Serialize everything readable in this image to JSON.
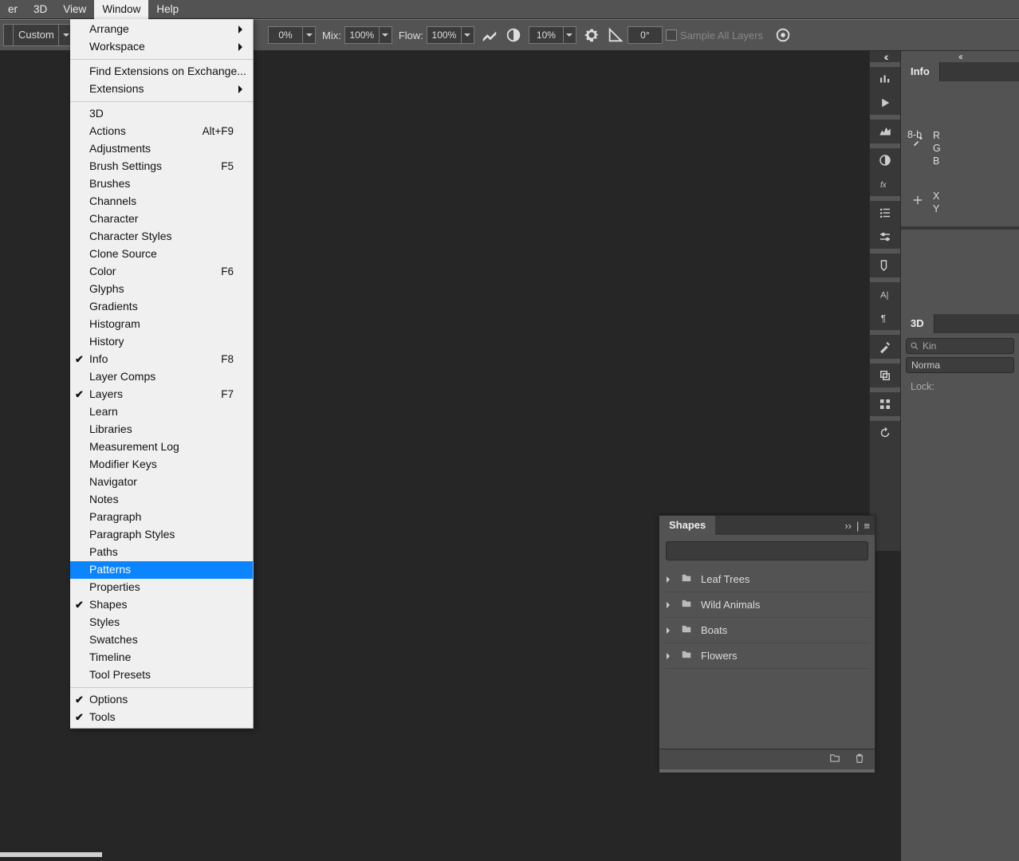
{
  "menubar": {
    "items": [
      {
        "label": "er",
        "active": false
      },
      {
        "label": "3D",
        "active": false
      },
      {
        "label": "View",
        "active": false
      },
      {
        "label": "Window",
        "active": true
      },
      {
        "label": "Help",
        "active": false
      }
    ]
  },
  "optionsbar": {
    "preset_name": "Custom",
    "pct_a": "0%",
    "mix_label": "Mix:",
    "mix_value": "100%",
    "flow_label": "Flow:",
    "flow_value": "100%",
    "smoothing_value": "10%",
    "angle_value": "0°",
    "sample_all_label": "Sample All Layers"
  },
  "window_menu": {
    "groups": [
      [
        {
          "label": "Arrange",
          "submenu": true
        },
        {
          "label": "Workspace",
          "submenu": true
        }
      ],
      [
        {
          "label": "Find Extensions on Exchange..."
        },
        {
          "label": "Extensions",
          "submenu": true
        }
      ],
      [
        {
          "label": "3D"
        },
        {
          "label": "Actions",
          "shortcut": "Alt+F9"
        },
        {
          "label": "Adjustments"
        },
        {
          "label": "Brush Settings",
          "shortcut": "F5"
        },
        {
          "label": "Brushes"
        },
        {
          "label": "Channels"
        },
        {
          "label": "Character"
        },
        {
          "label": "Character Styles"
        },
        {
          "label": "Clone Source"
        },
        {
          "label": "Color",
          "shortcut": "F6"
        },
        {
          "label": "Glyphs"
        },
        {
          "label": "Gradients"
        },
        {
          "label": "Histogram"
        },
        {
          "label": "History"
        },
        {
          "label": "Info",
          "shortcut": "F8",
          "checked": true
        },
        {
          "label": "Layer Comps"
        },
        {
          "label": "Layers",
          "shortcut": "F7",
          "checked": true
        },
        {
          "label": "Learn"
        },
        {
          "label": "Libraries"
        },
        {
          "label": "Measurement Log"
        },
        {
          "label": "Modifier Keys"
        },
        {
          "label": "Navigator"
        },
        {
          "label": "Notes"
        },
        {
          "label": "Paragraph"
        },
        {
          "label": "Paragraph Styles"
        },
        {
          "label": "Paths"
        },
        {
          "label": "Patterns",
          "highlight": true
        },
        {
          "label": "Properties"
        },
        {
          "label": "Shapes",
          "checked": true
        },
        {
          "label": "Styles"
        },
        {
          "label": "Swatches"
        },
        {
          "label": "Timeline"
        },
        {
          "label": "Tool Presets"
        }
      ],
      [
        {
          "label": "Options",
          "checked": true
        },
        {
          "label": "Tools",
          "checked": true
        }
      ]
    ]
  },
  "dock_icons": [
    "bar-chart",
    "play",
    "histogram",
    "half-circle",
    "fx",
    "brush-list",
    "brush-adjust",
    "patch",
    "character",
    "paragraph",
    "tools",
    "layers",
    "grid",
    "refresh"
  ],
  "info_panel": {
    "tab": "Info",
    "channels": [
      "R",
      "G",
      "B"
    ],
    "depth": "8-b",
    "axes": [
      "X",
      "Y"
    ]
  },
  "threeD_panel": {
    "tab": "3D",
    "search_placeholder": "Kin",
    "mode": "Norma",
    "lock_label": "Lock:"
  },
  "shapes_panel": {
    "tab": "Shapes",
    "folders": [
      {
        "name": "Leaf Trees"
      },
      {
        "name": "Wild Animals"
      },
      {
        "name": "Boats"
      },
      {
        "name": "Flowers"
      }
    ]
  }
}
